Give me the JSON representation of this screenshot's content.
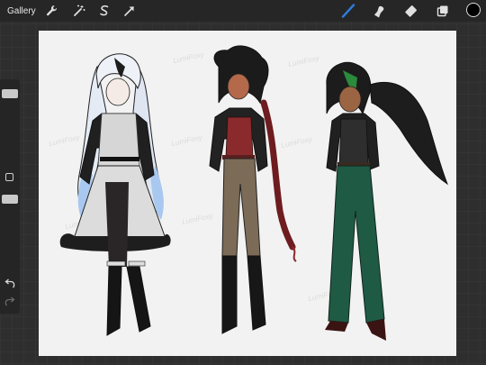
{
  "toolbar": {
    "gallery_label": "Gallery",
    "left_icons": [
      "wrench-icon",
      "magic-wand-icon",
      "selection-icon",
      "transform-arrow-icon"
    ],
    "right_icons": [
      "brush-icon",
      "smudge-icon",
      "eraser-icon",
      "layers-icon"
    ],
    "active_tool": "brush",
    "accent_color": "#2f7bdc",
    "current_color": "#000000"
  },
  "sidebar": {
    "controls": [
      "brush-size-slider",
      "modify-button",
      "opacity-slider",
      "undo-icon",
      "redo-icon"
    ]
  },
  "canvas": {
    "background": "#f2f2f2",
    "watermark": "LumiFoxy"
  }
}
